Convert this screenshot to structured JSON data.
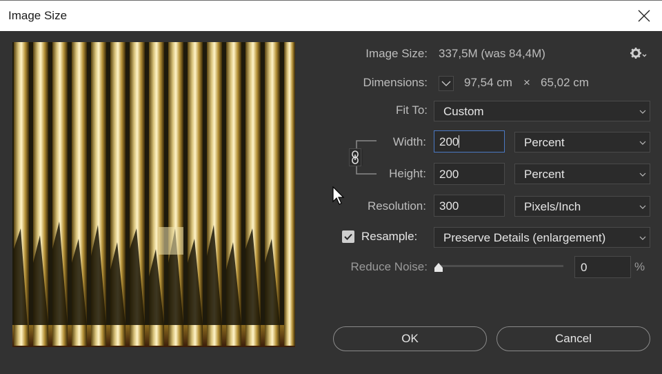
{
  "window": {
    "title": "Image Size"
  },
  "info": {
    "image_size_label": "Image Size:",
    "image_size_value": "337,5M (was 84,4M)",
    "dimensions_label": "Dimensions:",
    "dimensions_width": "97,54 cm",
    "dimensions_sep": "×",
    "dimensions_height": "65,02 cm"
  },
  "fit_to": {
    "label": "Fit To:",
    "value": "Custom"
  },
  "width": {
    "label": "Width:",
    "value": "200",
    "unit": "Percent"
  },
  "height": {
    "label": "Height:",
    "value": "200",
    "unit": "Percent"
  },
  "resolution": {
    "label": "Resolution:",
    "value": "300",
    "unit": "Pixels/Inch"
  },
  "resample": {
    "label": "Resample:",
    "checked": true,
    "value": "Preserve Details (enlargement)"
  },
  "reduce_noise": {
    "label": "Reduce Noise:",
    "value": "0",
    "unit": "%",
    "level": 0
  },
  "buttons": {
    "ok": "OK",
    "cancel": "Cancel"
  },
  "colors": {
    "dialog_bg": "#323232",
    "focus_border": "#4b79c4",
    "text": "#bdbdbd"
  },
  "icons": [
    "close-icon",
    "gear-icon",
    "chevron-down-icon",
    "link-icon",
    "checkmark-icon",
    "mouse-cursor-icon"
  ]
}
